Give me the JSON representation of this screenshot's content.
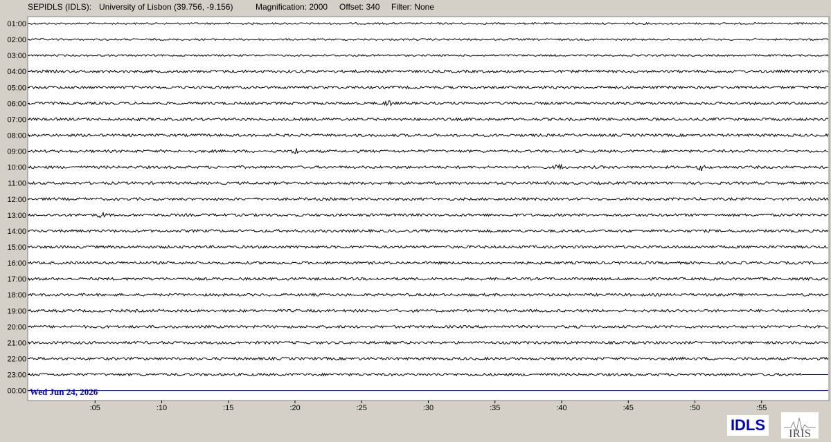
{
  "header": {
    "station": "SEPIDLS (IDLS):",
    "location": "University of Lisbon (39.756, -9.156)",
    "magnification": "Magnification: 2000",
    "offset": "Offset: 340",
    "filter": "Filter: None"
  },
  "date_label": "Wed Jun 24, 2026",
  "logos": {
    "idls": "IDLS",
    "iris": "IRIS"
  },
  "colors": {
    "background": "#d4d0c8",
    "plot_bg": "#ffffff",
    "trace": "#000000",
    "current": "#0000cc"
  },
  "chart_data": {
    "type": "line",
    "title": "",
    "xlabel": "",
    "ylabel": "",
    "x_ticks": [
      ":05",
      ":10",
      ":15",
      ":20",
      ":25",
      ":30",
      ":35",
      ":40",
      ":45",
      ":50",
      ":55"
    ],
    "xlim": [
      0,
      60
    ],
    "hours": [
      "01:00",
      "02:00",
      "03:00",
      "04:00",
      "05:00",
      "06:00",
      "07:00",
      "08:00",
      "09:00",
      "10:00",
      "11:00",
      "12:00",
      "13:00",
      "14:00",
      "15:00",
      "16:00",
      "17:00",
      "18:00",
      "19:00",
      "20:00",
      "21:00",
      "22:00",
      "23:00",
      "00:00"
    ],
    "trace_end_minutes": [
      60,
      60,
      60,
      60,
      60,
      60,
      60,
      60,
      60,
      60,
      60,
      60,
      60,
      60,
      60,
      60,
      60,
      60,
      60,
      60,
      60,
      60,
      58,
      0
    ],
    "events": [
      {
        "hour": "06:00",
        "minute": 27.0
      },
      {
        "hour": "09:00",
        "minute": 20.0
      },
      {
        "hour": "10:00",
        "minute": 39.8
      },
      {
        "hour": "10:00",
        "minute": 50.5
      },
      {
        "hour": "13:00",
        "minute": 5.5
      }
    ],
    "grid": false,
    "legend": "none"
  }
}
